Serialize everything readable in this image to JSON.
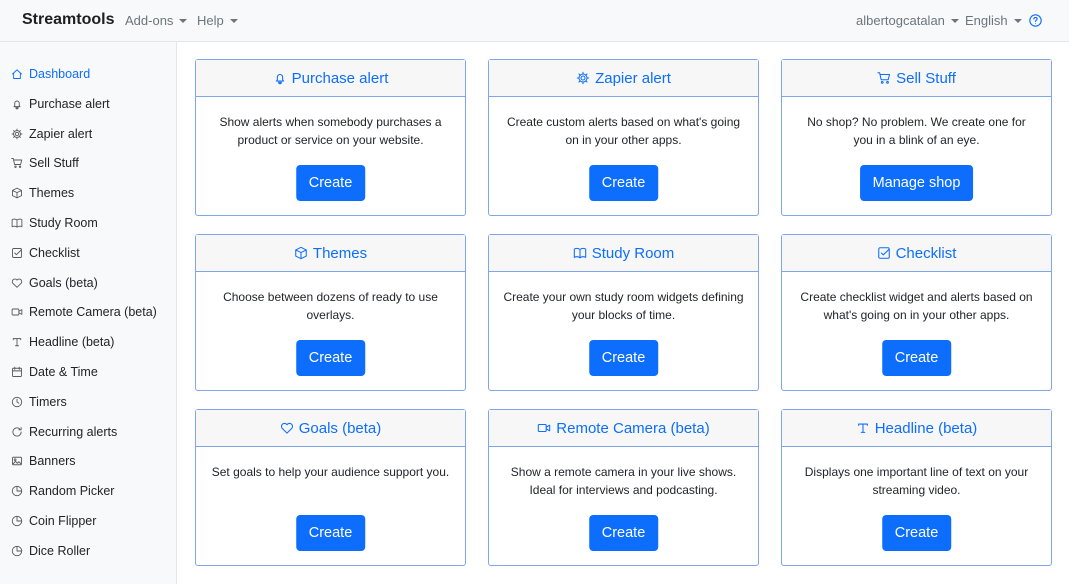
{
  "header": {
    "brand": "Streamtools",
    "addons": "Add-ons",
    "help": "Help",
    "user": "albertogcatalan",
    "language": "English",
    "help_icon": "question-circle-icon"
  },
  "sidebar": {
    "items": [
      {
        "label": "Dashboard",
        "icon": "house-icon",
        "active": true
      },
      {
        "label": "Purchase alert",
        "icon": "bell-icon"
      },
      {
        "label": "Zapier alert",
        "icon": "gear-icon"
      },
      {
        "label": "Sell Stuff",
        "icon": "cart-icon"
      },
      {
        "label": "Themes",
        "icon": "box-icon"
      },
      {
        "label": "Study Room",
        "icon": "book-icon"
      },
      {
        "label": "Checklist",
        "icon": "check-square-icon"
      },
      {
        "label": "Goals (beta)",
        "icon": "heart-icon"
      },
      {
        "label": "Remote Camera (beta)",
        "icon": "camera-video-icon"
      },
      {
        "label": "Headline (beta)",
        "icon": "type-icon"
      },
      {
        "label": "Date & Time",
        "icon": "calendar-icon"
      },
      {
        "label": "Timers",
        "icon": "clock-icon"
      },
      {
        "label": "Recurring alerts",
        "icon": "arrow-repeat-icon"
      },
      {
        "label": "Banners",
        "icon": "image-icon"
      },
      {
        "label": "Random Picker",
        "icon": "pie-chart-icon"
      },
      {
        "label": "Coin Flipper",
        "icon": "pie-chart-icon"
      },
      {
        "label": "Dice Roller",
        "icon": "pie-chart-icon"
      }
    ]
  },
  "cards": [
    {
      "title": "Purchase alert",
      "icon": "bell-icon",
      "text": "Show alerts when somebody purchases a product or service on your website.",
      "button": "Create"
    },
    {
      "title": "Zapier alert",
      "icon": "gear-icon",
      "text": "Create custom alerts based on what's going on in your other apps.",
      "button": "Create"
    },
    {
      "title": "Sell Stuff",
      "icon": "cart-icon",
      "text": "No shop? No problem. We create one for you in a blink of an eye.",
      "button": "Manage shop"
    },
    {
      "title": "Themes",
      "icon": "box-icon",
      "text": "Choose between dozens of ready to use overlays.",
      "button": "Create"
    },
    {
      "title": "Study Room",
      "icon": "book-icon",
      "text": "Create your own study room widgets defining your blocks of time.",
      "button": "Create"
    },
    {
      "title": "Checklist",
      "icon": "check-square-icon",
      "text": "Create checklist widget and alerts based on what's going on in your other apps.",
      "button": "Create"
    },
    {
      "title": "Goals (beta)",
      "icon": "heart-icon",
      "text": "Set goals to help your audience support you.",
      "button": "Create"
    },
    {
      "title": "Remote Camera (beta)",
      "icon": "camera-video-icon",
      "text": "Show a remote camera in your live shows. Ideal for interviews and podcasting.",
      "button": "Create"
    },
    {
      "title": "Headline (beta)",
      "icon": "type-icon",
      "text": "Displays one important line of text on your streaming video.",
      "button": "Create"
    }
  ],
  "colors": {
    "accent": "#0d6efd",
    "card_border": "#7fa6e8",
    "header_bg": "#f8f9fa"
  }
}
